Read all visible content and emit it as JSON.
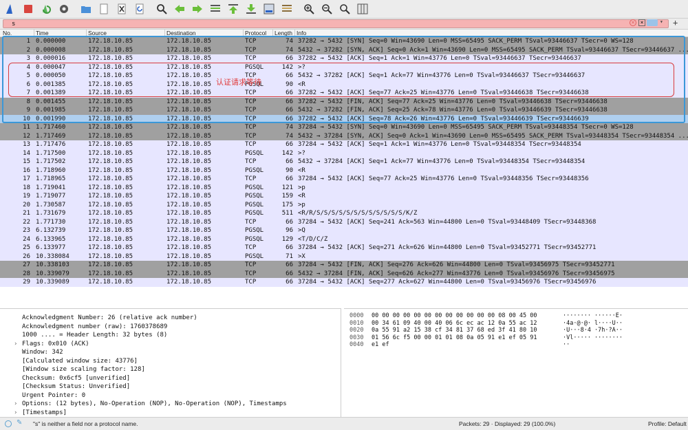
{
  "toolbar": {
    "icons": [
      "shark-fin-icon",
      "stop-capture-icon",
      "restart-capture-icon",
      "capture-options-icon",
      "open-folder-icon",
      "open-file-icon",
      "close-file-icon",
      "reload-icon",
      "find-icon",
      "go-back-icon",
      "go-forward-icon",
      "go-to-packet-icon",
      "go-first-icon",
      "go-last-icon",
      "auto-scroll-icon",
      "colorize-icon",
      "zoom-in-icon",
      "zoom-out-icon",
      "zoom-normal-icon",
      "resize-columns-icon"
    ]
  },
  "filter": {
    "value": "s",
    "clear_label": "×",
    "bookmark_label": "×",
    "dropdown_label": "▾",
    "plus_label": "+"
  },
  "columns": [
    "No.",
    "Time",
    "Source",
    "Destination",
    "Protocol",
    "Length",
    "Info"
  ],
  "packets": [
    {
      "no": "1",
      "time": "0.000000",
      "src": "172.18.10.85",
      "dst": "172.18.10.85",
      "proto": "TCP",
      "len": "74",
      "info": "37282 → 5432 [SYN] Seq=0 Win=43690 Len=0 MSS=65495 SACK_PERM TSval=93446637 TSecr=0 WS=128",
      "style": "dark"
    },
    {
      "no": "2",
      "time": "0.000008",
      "src": "172.18.10.85",
      "dst": "172.18.10.85",
      "proto": "TCP",
      "len": "74",
      "info": "5432 → 37282 [SYN, ACK] Seq=0 Ack=1 Win=43690 Len=0 MSS=65495 SACK_PERM TSval=93446637 TSecr=93446637 ...",
      "style": "dark"
    },
    {
      "no": "3",
      "time": "0.000016",
      "src": "172.18.10.85",
      "dst": "172.18.10.85",
      "proto": "TCP",
      "len": "66",
      "info": "37282 → 5432 [ACK] Seq=1 Ack=1 Win=43776 Len=0 TSval=93446637 TSecr=93446637",
      "style": "light"
    },
    {
      "no": "4",
      "time": "0.000047",
      "src": "172.18.10.85",
      "dst": "172.18.10.85",
      "proto": "PGSQL",
      "len": "142",
      "info": ">?",
      "style": "light"
    },
    {
      "no": "5",
      "time": "0.000050",
      "src": "172.18.10.85",
      "dst": "172.18.10.85",
      "proto": "TCP",
      "len": "66",
      "info": "5432 → 37282 [ACK] Seq=1 Ack=77 Win=43776 Len=0 TSval=93446637 TSecr=93446637",
      "style": "light"
    },
    {
      "no": "6",
      "time": "0.001385",
      "src": "172.18.10.85",
      "dst": "172.18.10.85",
      "proto": "PGSQL",
      "len": "90",
      "info": "<R",
      "style": "light"
    },
    {
      "no": "7",
      "time": "0.001389",
      "src": "172.18.10.85",
      "dst": "172.18.10.85",
      "proto": "TCP",
      "len": "66",
      "info": "37282 → 5432 [ACK] Seq=77 Ack=25 Win=43776 Len=0 TSval=93446638 TSecr=93446638",
      "style": "light"
    },
    {
      "no": "8",
      "time": "0.001455",
      "src": "172.18.10.85",
      "dst": "172.18.10.85",
      "proto": "TCP",
      "len": "66",
      "info": "37282 → 5432 [FIN, ACK] Seq=77 Ack=25 Win=43776 Len=0 TSval=93446638 TSecr=93446638",
      "style": "dark"
    },
    {
      "no": "9",
      "time": "0.001985",
      "src": "172.18.10.85",
      "dst": "172.18.10.85",
      "proto": "TCP",
      "len": "66",
      "info": "5432 → 37282 [FIN, ACK] Seq=25 Ack=78 Win=43776 Len=0 TSval=93446639 TSecr=93446638",
      "style": "dark"
    },
    {
      "no": "10",
      "time": "0.001990",
      "src": "172.18.10.85",
      "dst": "172.18.10.85",
      "proto": "TCP",
      "len": "66",
      "info": "37282 → 5432 [ACK] Seq=78 Ack=26 Win=43776 Len=0 TSval=93446639 TSecr=93446639",
      "style": "sel"
    },
    {
      "no": "11",
      "time": "1.717460",
      "src": "172.18.10.85",
      "dst": "172.18.10.85",
      "proto": "TCP",
      "len": "74",
      "info": "37284 → 5432 [SYN] Seq=0 Win=43690 Len=0 MSS=65495 SACK_PERM TSval=93448354 TSecr=0 WS=128",
      "style": "dark"
    },
    {
      "no": "12",
      "time": "1.717469",
      "src": "172.18.10.85",
      "dst": "172.18.10.85",
      "proto": "TCP",
      "len": "74",
      "info": "5432 → 37284 [SYN, ACK] Seq=0 Ack=1 Win=43690 Len=0 MSS=65495 SACK_PERM TSval=93448354 TSecr=93448354 ...",
      "style": "dark"
    },
    {
      "no": "13",
      "time": "1.717476",
      "src": "172.18.10.85",
      "dst": "172.18.10.85",
      "proto": "TCP",
      "len": "66",
      "info": "37284 → 5432 [ACK] Seq=1 Ack=1 Win=43776 Len=0 TSval=93448354 TSecr=93448354",
      "style": "light"
    },
    {
      "no": "14",
      "time": "1.717500",
      "src": "172.18.10.85",
      "dst": "172.18.10.85",
      "proto": "PGSQL",
      "len": "142",
      "info": ">?",
      "style": "light"
    },
    {
      "no": "15",
      "time": "1.717502",
      "src": "172.18.10.85",
      "dst": "172.18.10.85",
      "proto": "TCP",
      "len": "66",
      "info": "5432 → 37284 [ACK] Seq=1 Ack=77 Win=43776 Len=0 TSval=93448354 TSecr=93448354",
      "style": "light"
    },
    {
      "no": "16",
      "time": "1.718960",
      "src": "172.18.10.85",
      "dst": "172.18.10.85",
      "proto": "PGSQL",
      "len": "90",
      "info": "<R",
      "style": "light"
    },
    {
      "no": "17",
      "time": "1.718965",
      "src": "172.18.10.85",
      "dst": "172.18.10.85",
      "proto": "TCP",
      "len": "66",
      "info": "37284 → 5432 [ACK] Seq=77 Ack=25 Win=43776 Len=0 TSval=93448356 TSecr=93448356",
      "style": "light"
    },
    {
      "no": "18",
      "time": "1.719041",
      "src": "172.18.10.85",
      "dst": "172.18.10.85",
      "proto": "PGSQL",
      "len": "121",
      "info": ">p",
      "style": "light"
    },
    {
      "no": "19",
      "time": "1.719077",
      "src": "172.18.10.85",
      "dst": "172.18.10.85",
      "proto": "PGSQL",
      "len": "159",
      "info": "<R",
      "style": "light"
    },
    {
      "no": "20",
      "time": "1.730587",
      "src": "172.18.10.85",
      "dst": "172.18.10.85",
      "proto": "PGSQL",
      "len": "175",
      "info": ">p",
      "style": "light"
    },
    {
      "no": "21",
      "time": "1.731679",
      "src": "172.18.10.85",
      "dst": "172.18.10.85",
      "proto": "PGSQL",
      "len": "511",
      "info": "<R/R/S/S/S/S/S/S/S/S/S/S/S/S/K/Z",
      "style": "light"
    },
    {
      "no": "22",
      "time": "1.771730",
      "src": "172.18.10.85",
      "dst": "172.18.10.85",
      "proto": "TCP",
      "len": "66",
      "info": "37284 → 5432 [ACK] Seq=241 Ack=563 Win=44800 Len=0 TSval=93448409 TSecr=93448368",
      "style": "light"
    },
    {
      "no": "23",
      "time": "6.132739",
      "src": "172.18.10.85",
      "dst": "172.18.10.85",
      "proto": "PGSQL",
      "len": "96",
      "info": ">Q",
      "style": "light"
    },
    {
      "no": "24",
      "time": "6.133965",
      "src": "172.18.10.85",
      "dst": "172.18.10.85",
      "proto": "PGSQL",
      "len": "129",
      "info": "<T/D/C/Z",
      "style": "light"
    },
    {
      "no": "25",
      "time": "6.133977",
      "src": "172.18.10.85",
      "dst": "172.18.10.85",
      "proto": "TCP",
      "len": "66",
      "info": "37284 → 5432 [ACK] Seq=271 Ack=626 Win=44800 Len=0 TSval=93452771 TSecr=93452771",
      "style": "light"
    },
    {
      "no": "26",
      "time": "10.338084",
      "src": "172.18.10.85",
      "dst": "172.18.10.85",
      "proto": "PGSQL",
      "len": "71",
      "info": ">X",
      "style": "light"
    },
    {
      "no": "27",
      "time": "10.338103",
      "src": "172.18.10.85",
      "dst": "172.18.10.85",
      "proto": "TCP",
      "len": "66",
      "info": "37284 → 5432 [FIN, ACK] Seq=276 Ack=626 Win=44800 Len=0 TSval=93456975 TSecr=93452771",
      "style": "dark"
    },
    {
      "no": "28",
      "time": "10.339079",
      "src": "172.18.10.85",
      "dst": "172.18.10.85",
      "proto": "TCP",
      "len": "66",
      "info": "5432 → 37284 [FIN, ACK] Seq=626 Ack=277 Win=43776 Len=0 TSval=93456976 TSecr=93456975",
      "style": "dark"
    },
    {
      "no": "29",
      "time": "10.339089",
      "src": "172.18.10.85",
      "dst": "172.18.10.85",
      "proto": "TCP",
      "len": "66",
      "info": "37284 → 5432 [ACK] Seq=277 Ack=627 Win=44800 Len=0 TSval=93456976 TSecr=93456976",
      "style": "light"
    }
  ],
  "annotation": "认证请求等待",
  "details": [
    {
      "text": "Acknowledgment Number: 26    (relative ack number)",
      "expandable": false
    },
    {
      "text": "Acknowledgment number (raw): 1760378689",
      "expandable": false
    },
    {
      "text": "1000 .... = Header Length: 32 bytes (8)",
      "expandable": false
    },
    {
      "text": "Flags: 0x010 (ACK)",
      "expandable": true
    },
    {
      "text": "Window: 342",
      "expandable": false
    },
    {
      "text": "[Calculated window size: 43776]",
      "expandable": false
    },
    {
      "text": "[Window size scaling factor: 128]",
      "expandable": false
    },
    {
      "text": "Checksum: 0x6cf5 [unverified]",
      "expandable": false
    },
    {
      "text": "[Checksum Status: Unverified]",
      "expandable": false
    },
    {
      "text": "Urgent Pointer: 0",
      "expandable": false
    },
    {
      "text": "Options: (12 bytes), No-Operation (NOP), No-Operation (NOP), Timestamps",
      "expandable": true
    },
    {
      "text": "[Timestamps]",
      "expandable": true
    }
  ],
  "bytes": [
    {
      "offset": "0000",
      "hex": "00 00 00 00 00 00 00 00  00 00 00 00 08 00 45 00",
      "ascii": "········ ······E·"
    },
    {
      "offset": "0010",
      "hex": "00 34 61 09 40 00 40 06  6c ec ac 12 0a 55 ac 12",
      "ascii": "·4a·@·@· l····U··"
    },
    {
      "offset": "0020",
      "hex": "0a 55 91 a2 15 38 cf 34  81 37 68 ed 3f 41 80 10",
      "ascii": "·U···8·4 ·7h·?A··"
    },
    {
      "offset": "0030",
      "hex": "01 56 6c f5 00 00 01 01  08 0a 05 91 e1 ef 05 91",
      "ascii": "·Vl····· ········"
    },
    {
      "offset": "0040",
      "hex": "e1 ef",
      "ascii": "··"
    }
  ],
  "status": {
    "message": "\"s\" is neither a field nor a protocol name.",
    "packets": "Packets: 29 · Displayed: 29 (100.0%)",
    "profile": "Profile: Default"
  },
  "colors": {
    "light_row": "#e7e6ff",
    "dark_row": "#a0a0a0",
    "selected_row": "#afcfef",
    "filter_invalid": "#f6b3b3",
    "annotation_red": "#e03a3a",
    "frame_blue": "#3a97d8"
  }
}
